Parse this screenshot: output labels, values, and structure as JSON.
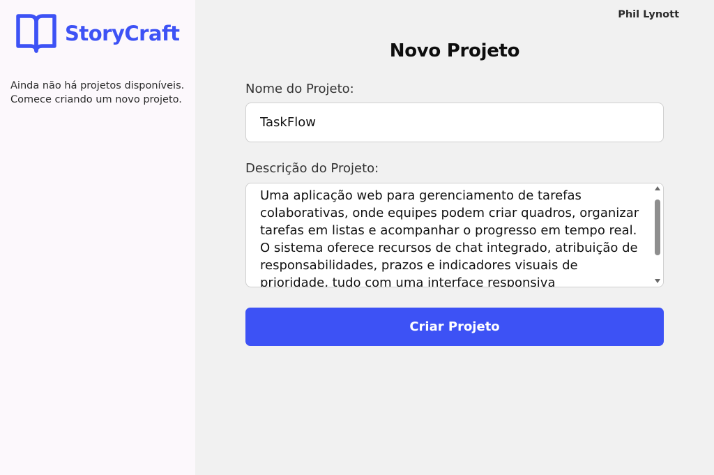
{
  "brand": {
    "name": "StoryCraft",
    "icon": "open-book-icon",
    "color": "#3d52f5"
  },
  "sidebar": {
    "empty_line1": "Ainda não há projetos disponíveis.",
    "empty_line2": "Comece criando um novo projeto."
  },
  "header": {
    "user_name": "Phil Lynott"
  },
  "form": {
    "title": "Novo Projeto",
    "name_label": "Nome do Projeto:",
    "name_value": "TaskFlow",
    "description_label": "Descrição do Projeto:",
    "description_value": "Uma aplicação web para gerenciamento de tarefas colaborativas, onde equipes podem criar quadros, organizar tarefas em listas e acompanhar o progresso em tempo real. O sistema oferece recursos de chat integrado, atribuição de responsabilidades, prazos e indicadores visuais de prioridade, tudo com uma interface responsiva",
    "submit_label": "Criar Projeto"
  },
  "colors": {
    "accent": "#3d52f5",
    "sidebar_bg": "#fcf8fc",
    "main_bg": "#f1f1f1"
  }
}
